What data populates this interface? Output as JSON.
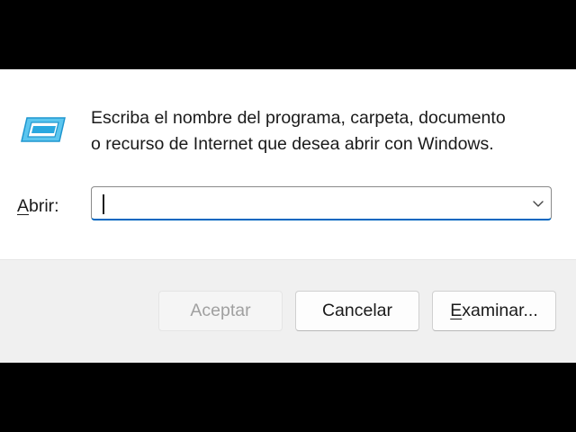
{
  "dialog": {
    "description_line1": "Escriba el nombre del programa, carpeta, documento",
    "description_line2": "o recurso de Internet que desea abrir con Windows.",
    "icon": "run-icon",
    "open_label_access": "A",
    "open_label_rest": "brir:",
    "open_input": {
      "value": "",
      "icon": "chevron-down-icon"
    },
    "buttons": {
      "accept_label": "Aceptar",
      "cancel_label": "Cancelar",
      "browse_label_access": "E",
      "browse_label_rest": "xaminar..."
    },
    "colors": {
      "accent": "#0067c0",
      "icon_blue": "#29a8e0",
      "footer_bg": "#f0f0f0",
      "disabled_text": "#a0a0a0"
    }
  }
}
